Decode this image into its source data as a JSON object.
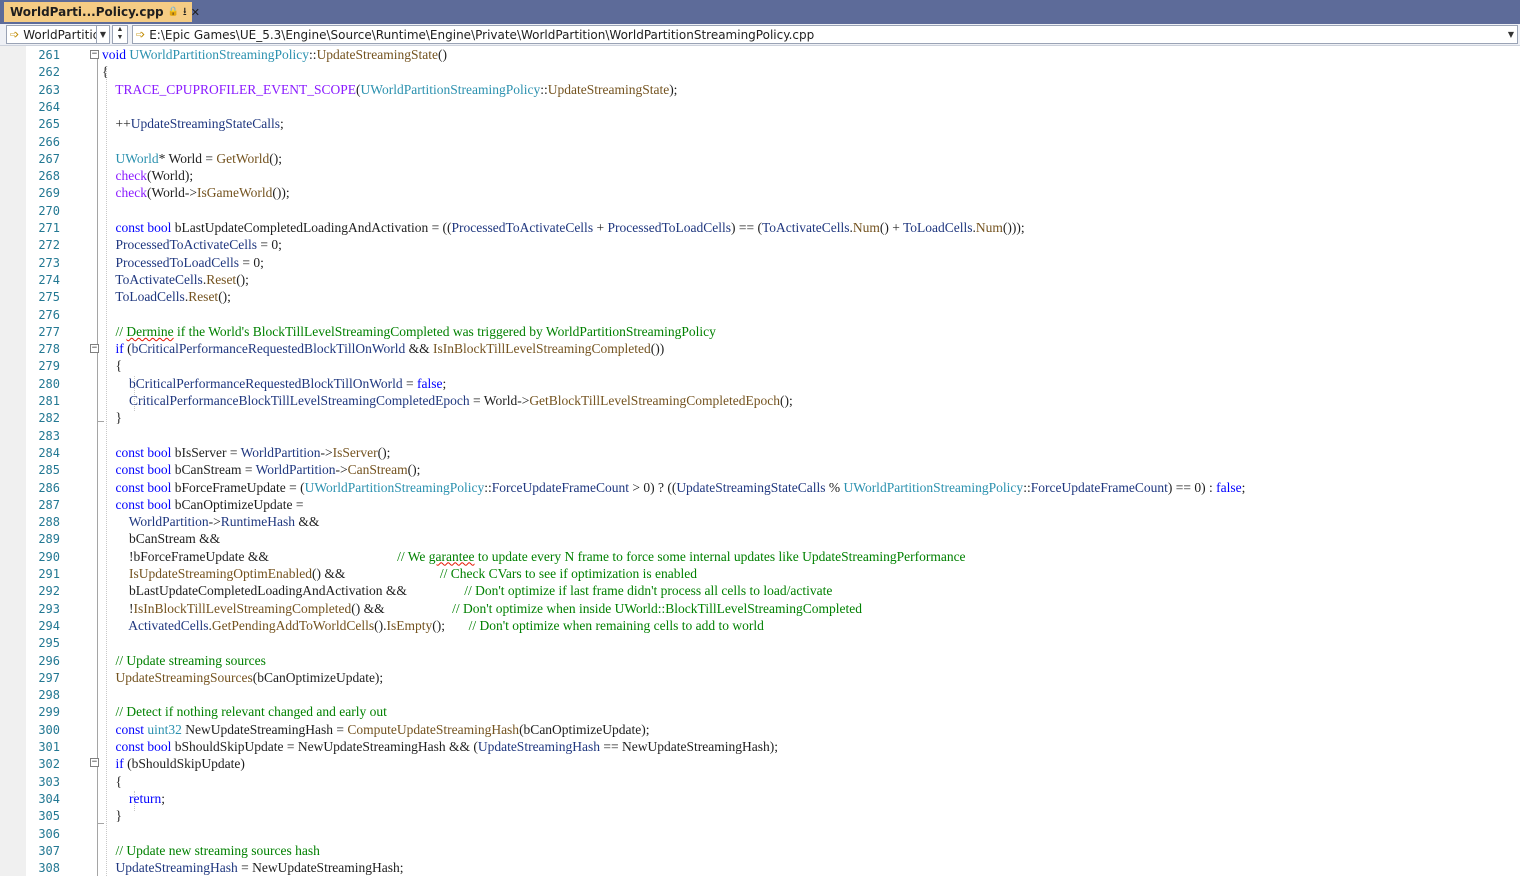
{
  "tab": {
    "title": "WorldParti...Policy.cpp",
    "lock": "🔒",
    "pin": "⭳",
    "close": "✕"
  },
  "nav": {
    "scope": "WorldPartitic",
    "path": "E:\\Epic Games\\UE_5.3\\Engine\\Source\\Runtime\\Engine\\Private\\WorldPartition\\WorldPartitionStreamingPolicy.cpp"
  },
  "colors": {
    "keyword": "#0000ff",
    "type": "#2b91af",
    "function": "#74531f",
    "macro": "#8a1bff",
    "comment": "#008000",
    "member": "#1f377f",
    "tab": "#f5cc84",
    "titlebar": "#5d6b99",
    "linenumber": "#237893"
  },
  "lines": [
    {
      "n": "261",
      "t": [
        [
          "kw",
          "void"
        ],
        [
          "",
          ""
        ],
        [
          "ty",
          "UWorldPartitionStreamingPolicy"
        ],
        [
          "",
          "::"
        ],
        [
          "fn",
          "UpdateStreamingState"
        ],
        [
          "",
          "()"
        ]
      ],
      "sp": [
        1,
        0,
        0,
        0,
        0,
        0
      ]
    },
    {
      "n": "262",
      "t": [
        [
          "",
          "{"
        ]
      ]
    },
    {
      "n": "263",
      "t": [
        [
          "",
          "    "
        ],
        [
          "mc",
          "TRACE_CPUPROFILER_EVENT_SCOPE"
        ],
        [
          "",
          "("
        ],
        [
          "ty",
          "UWorldPartitionStreamingPolicy"
        ],
        [
          "",
          "::"
        ],
        [
          "fn",
          "UpdateStreamingState"
        ],
        [
          "",
          ");"
        ]
      ]
    },
    {
      "n": "264",
      "t": []
    },
    {
      "n": "265",
      "t": [
        [
          "",
          "    ++"
        ],
        [
          "mem",
          "UpdateStreamingStateCalls"
        ],
        [
          "",
          ";"
        ]
      ]
    },
    {
      "n": "266",
      "t": []
    },
    {
      "n": "267",
      "t": [
        [
          "",
          "    "
        ],
        [
          "ty",
          "UWorld"
        ],
        [
          "",
          "* World = "
        ],
        [
          "fn",
          "GetWorld"
        ],
        [
          "",
          "();"
        ]
      ]
    },
    {
      "n": "268",
      "t": [
        [
          "",
          "    "
        ],
        [
          "mc",
          "check"
        ],
        [
          "",
          "(World);"
        ]
      ]
    },
    {
      "n": "269",
      "t": [
        [
          "",
          "    "
        ],
        [
          "mc",
          "check"
        ],
        [
          "",
          "(World->"
        ],
        [
          "fn",
          "IsGameWorld"
        ],
        [
          "",
          "());"
        ]
      ]
    },
    {
      "n": "270",
      "t": []
    },
    {
      "n": "271",
      "t": [
        [
          "",
          "    "
        ],
        [
          "kw",
          "const bool"
        ],
        [
          "",
          " bLastUpdateCompletedLoadingAndActivation = (("
        ],
        [
          "mem",
          "ProcessedToActivateCells"
        ],
        [
          "",
          " + "
        ],
        [
          "mem",
          "ProcessedToLoadCells"
        ],
        [
          "",
          ") == ("
        ],
        [
          "mem",
          "ToActivateCells"
        ],
        [
          "",
          "."
        ],
        [
          "fn",
          "Num"
        ],
        [
          "",
          "() + "
        ],
        [
          "mem",
          "ToLoadCells"
        ],
        [
          "",
          "."
        ],
        [
          "fn",
          "Num"
        ],
        [
          "",
          "()));"
        ]
      ]
    },
    {
      "n": "272",
      "t": [
        [
          "",
          "    "
        ],
        [
          "mem",
          "ProcessedToActivateCells"
        ],
        [
          "",
          " = 0;"
        ]
      ]
    },
    {
      "n": "273",
      "t": [
        [
          "",
          "    "
        ],
        [
          "mem",
          "ProcessedToLoadCells"
        ],
        [
          "",
          " = 0;"
        ]
      ]
    },
    {
      "n": "274",
      "t": [
        [
          "",
          "    "
        ],
        [
          "mem",
          "ToActivateCells"
        ],
        [
          "",
          "."
        ],
        [
          "fn",
          "Reset"
        ],
        [
          "",
          "();"
        ]
      ]
    },
    {
      "n": "275",
      "t": [
        [
          "",
          "    "
        ],
        [
          "mem",
          "ToLoadCells"
        ],
        [
          "",
          "."
        ],
        [
          "fn",
          "Reset"
        ],
        [
          "",
          "();"
        ]
      ]
    },
    {
      "n": "276",
      "t": []
    },
    {
      "n": "277",
      "t": [
        [
          "cm",
          "    // "
        ],
        [
          "sq",
          "Dermine"
        ],
        [
          "cm",
          " if the World's BlockTillLevelStreamingCompleted was triggered by WorldPartitionStreamingPolicy"
        ]
      ]
    },
    {
      "n": "278",
      "t": [
        [
          "",
          "    "
        ],
        [
          "kw",
          "if"
        ],
        [
          "",
          " ("
        ],
        [
          "mem",
          "bCriticalPerformanceRequestedBlockTillOnWorld"
        ],
        [
          "",
          " && "
        ],
        [
          "fn",
          "IsInBlockTillLevelStreamingCompleted"
        ],
        [
          "",
          "())"
        ]
      ]
    },
    {
      "n": "279",
      "t": [
        [
          "",
          "    {"
        ]
      ]
    },
    {
      "n": "280",
      "t": [
        [
          "",
          "        "
        ],
        [
          "mem",
          "bCriticalPerformanceRequestedBlockTillOnWorld"
        ],
        [
          "",
          " = "
        ],
        [
          "kw",
          "false"
        ],
        [
          "",
          ";"
        ]
      ]
    },
    {
      "n": "281",
      "t": [
        [
          "",
          "        "
        ],
        [
          "mem",
          "CriticalPerformanceBlockTillLevelStreamingCompletedEpoch"
        ],
        [
          "",
          " = World->"
        ],
        [
          "fn",
          "GetBlockTillLevelStreamingCompletedEpoch"
        ],
        [
          "",
          "();"
        ]
      ]
    },
    {
      "n": "282",
      "t": [
        [
          "",
          "    }"
        ]
      ]
    },
    {
      "n": "283",
      "t": []
    },
    {
      "n": "284",
      "t": [
        [
          "",
          "    "
        ],
        [
          "kw",
          "const bool"
        ],
        [
          "",
          " bIsServer = "
        ],
        [
          "mem",
          "WorldPartition"
        ],
        [
          "",
          "->"
        ],
        [
          "fn",
          "IsServer"
        ],
        [
          "",
          "();"
        ]
      ]
    },
    {
      "n": "285",
      "t": [
        [
          "",
          "    "
        ],
        [
          "kw",
          "const bool"
        ],
        [
          "",
          " bCanStream = "
        ],
        [
          "mem",
          "WorldPartition"
        ],
        [
          "",
          "->"
        ],
        [
          "fn",
          "CanStream"
        ],
        [
          "",
          "();"
        ]
      ]
    },
    {
      "n": "286",
      "t": [
        [
          "",
          "    "
        ],
        [
          "kw",
          "const bool"
        ],
        [
          "",
          " bForceFrameUpdate = ("
        ],
        [
          "ty",
          "UWorldPartitionStreamingPolicy"
        ],
        [
          "",
          "::"
        ],
        [
          "mem",
          "ForceUpdateFrameCount"
        ],
        [
          "",
          " > 0) ? (("
        ],
        [
          "mem",
          "UpdateStreamingStateCalls"
        ],
        [
          "",
          " % "
        ],
        [
          "ty",
          "UWorldPartitionStreamingPolicy"
        ],
        [
          "",
          "::"
        ],
        [
          "mem",
          "ForceUpdateFrameCount"
        ],
        [
          "",
          ") == 0) : "
        ],
        [
          "kw",
          "false"
        ],
        [
          "",
          ";"
        ]
      ]
    },
    {
      "n": "287",
      "t": [
        [
          "",
          "    "
        ],
        [
          "kw",
          "const bool"
        ],
        [
          "",
          " bCanOptimizeUpdate ="
        ]
      ]
    },
    {
      "n": "288",
      "t": [
        [
          "",
          "        "
        ],
        [
          "mem",
          "WorldPartition"
        ],
        [
          "",
          "->"
        ],
        [
          "mem",
          "RuntimeHash"
        ],
        [
          "",
          " &&"
        ]
      ]
    },
    {
      "n": "289",
      "t": [
        [
          "",
          "        bCanStream &&"
        ]
      ]
    },
    {
      "n": "290",
      "t": [
        [
          "",
          "        !bForceFrameUpdate &&                                      "
        ],
        [
          "cm",
          "// We "
        ],
        [
          "sq",
          "garantee"
        ],
        [
          "cm",
          " to update every N frame to force some internal updates like UpdateStreamingPerformance"
        ]
      ]
    },
    {
      "n": "291",
      "t": [
        [
          "",
          "        "
        ],
        [
          "fn",
          "IsUpdateStreamingOptimEnabled"
        ],
        [
          "",
          "() &&                            "
        ],
        [
          "cm",
          "// Check CVars to see if optimization is enabled"
        ]
      ]
    },
    {
      "n": "292",
      "t": [
        [
          "",
          "        bLastUpdateCompletedLoadingAndActivation &&                 "
        ],
        [
          "cm",
          "// Don't optimize if last frame didn't process all cells to load/activate"
        ]
      ]
    },
    {
      "n": "293",
      "t": [
        [
          "",
          "        !"
        ],
        [
          "fn",
          "IsInBlockTillLevelStreamingCompleted"
        ],
        [
          "",
          "() &&                    "
        ],
        [
          "cm",
          "// Don't optimize when inside UWorld::BlockTillLevelStreamingCompleted"
        ]
      ]
    },
    {
      "n": "294",
      "t": [
        [
          "",
          "        "
        ],
        [
          "mem",
          "ActivatedCells"
        ],
        [
          "",
          "."
        ],
        [
          "fn",
          "GetPendingAddToWorldCells"
        ],
        [
          "",
          "()."
        ],
        [
          "fn",
          "IsEmpty"
        ],
        [
          "",
          "();       "
        ],
        [
          "cm",
          "// Don't optimize when remaining cells to add to world"
        ]
      ]
    },
    {
      "n": "295",
      "t": []
    },
    {
      "n": "296",
      "t": [
        [
          "cm",
          "    // Update streaming sources"
        ]
      ]
    },
    {
      "n": "297",
      "t": [
        [
          "",
          "    "
        ],
        [
          "fn",
          "UpdateStreamingSources"
        ],
        [
          "",
          "(bCanOptimizeUpdate);"
        ]
      ]
    },
    {
      "n": "298",
      "t": []
    },
    {
      "n": "299",
      "t": [
        [
          "cm",
          "    // Detect if nothing relevant changed and early out"
        ]
      ]
    },
    {
      "n": "300",
      "t": [
        [
          "",
          "    "
        ],
        [
          "kw",
          "const"
        ],
        [
          "",
          " "
        ],
        [
          "ty",
          "uint32"
        ],
        [
          "",
          " NewUpdateStreamingHash = "
        ],
        [
          "fn",
          "ComputeUpdateStreamingHash"
        ],
        [
          "",
          "(bCanOptimizeUpdate);"
        ]
      ]
    },
    {
      "n": "301",
      "t": [
        [
          "",
          "    "
        ],
        [
          "kw",
          "const bool"
        ],
        [
          "",
          " bShouldSkipUpdate = NewUpdateStreamingHash && ("
        ],
        [
          "mem",
          "UpdateStreamingHash"
        ],
        [
          "",
          " == NewUpdateStreamingHash);"
        ]
      ]
    },
    {
      "n": "302",
      "t": [
        [
          "",
          "    "
        ],
        [
          "kw",
          "if"
        ],
        [
          "",
          " (bShouldSkipUpdate)"
        ]
      ]
    },
    {
      "n": "303",
      "t": [
        [
          "",
          "    {"
        ]
      ]
    },
    {
      "n": "304",
      "t": [
        [
          "",
          "        "
        ],
        [
          "kw",
          "return"
        ],
        [
          "",
          ";"
        ]
      ]
    },
    {
      "n": "305",
      "t": [
        [
          "",
          "    }"
        ]
      ]
    },
    {
      "n": "306",
      "t": []
    },
    {
      "n": "307",
      "t": [
        [
          "cm",
          "    // Update new streaming sources hash"
        ]
      ]
    },
    {
      "n": "308",
      "t": [
        [
          "",
          "    "
        ],
        [
          "mem",
          "UpdateStreamingHash"
        ],
        [
          "",
          " = NewUpdateStreamingHash;"
        ]
      ]
    }
  ]
}
